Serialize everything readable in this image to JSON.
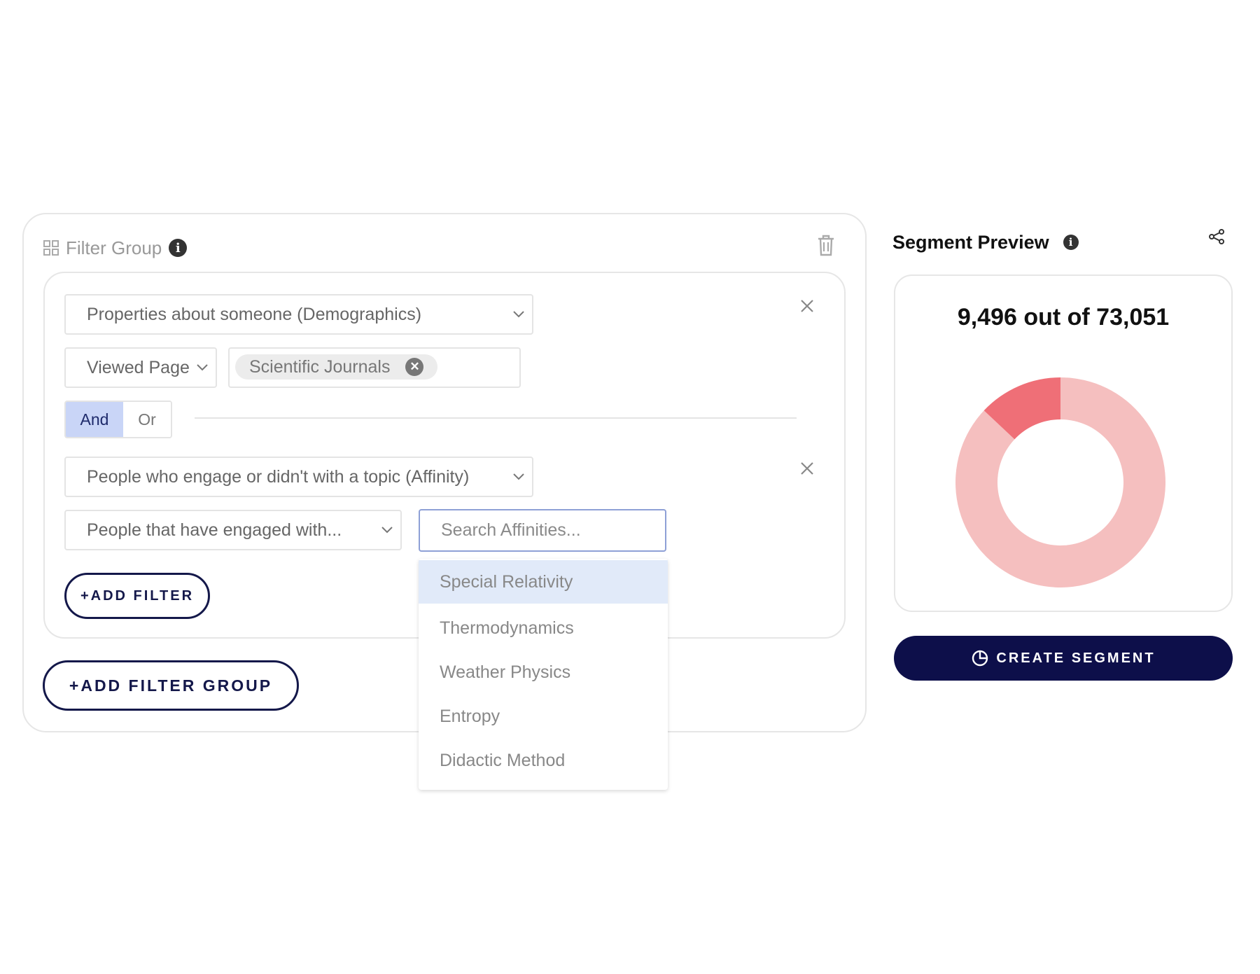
{
  "filter_group": {
    "title": "Filter Group",
    "filters": [
      {
        "category": "Properties about someone (Demographics)",
        "condition": "Viewed Page",
        "tag": "Scientific Journals"
      },
      {
        "category": "People who engage or didn't with a topic (Affinity)",
        "condition": "People that have engaged with...",
        "search_placeholder": "Search Affinities..."
      }
    ],
    "logic": {
      "and_label": "And",
      "or_label": "Or",
      "selected": "And"
    },
    "add_filter_label": "+ADD FILTER",
    "add_filter_group_label": "+ADD FILTER GROUP"
  },
  "affinity_dropdown": {
    "options": [
      "Special Relativity",
      "Thermodynamics",
      "Weather Physics",
      "Entropy",
      "Didactic Method"
    ],
    "highlighted": "Special Relativity"
  },
  "segment_preview": {
    "title": "Segment Preview",
    "count_text": "9,496 out of 73,051",
    "matched": 9496,
    "total": 73051,
    "colors": {
      "matched": "#ef6f77",
      "rest": "#f5bfbf"
    },
    "create_label": "CREATE SEGMENT"
  },
  "icons": [
    "grid-icon",
    "info-icon",
    "trash-icon",
    "close-icon",
    "chevron-down-icon",
    "share-icon",
    "pie-chart-icon"
  ]
}
